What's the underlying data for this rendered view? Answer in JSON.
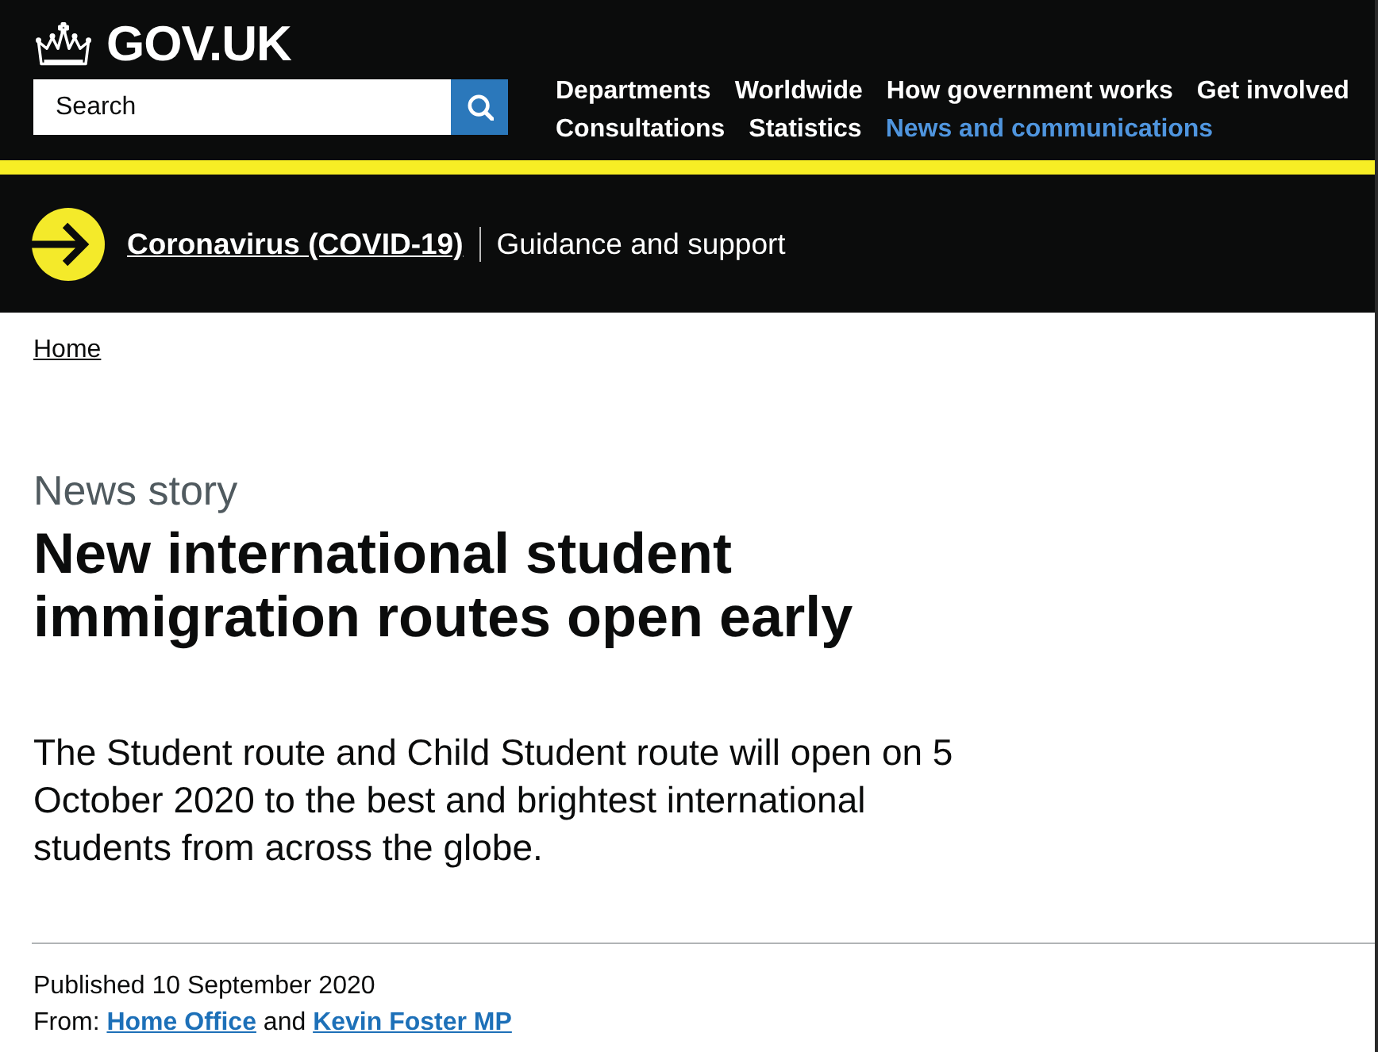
{
  "header": {
    "logo": "GOV.UK",
    "search": {
      "placeholder": "Search"
    },
    "nav": [
      {
        "label": "Departments",
        "selected": false
      },
      {
        "label": "Worldwide",
        "selected": false
      },
      {
        "label": "How government works",
        "selected": false
      },
      {
        "label": "Get involved",
        "selected": false
      },
      {
        "label": "Consultations",
        "selected": false
      },
      {
        "label": "Statistics",
        "selected": false
      },
      {
        "label": "News and communications",
        "selected": true
      }
    ]
  },
  "banner": {
    "link": "Coronavirus (COVID-19)",
    "text": "Guidance and support"
  },
  "breadcrumbs": [
    "Home"
  ],
  "article": {
    "type": "News story",
    "title": "New international student immigration routes open early",
    "summary": "The Student route and Child Student route will open on 5 October 2020 to the best and brightest international students from across the globe.",
    "published": "Published 10 September 2020",
    "from": {
      "prefix": "From:",
      "links": [
        "Home Office",
        "Kevin Foster MP"
      ],
      "joiner": "and"
    }
  }
}
